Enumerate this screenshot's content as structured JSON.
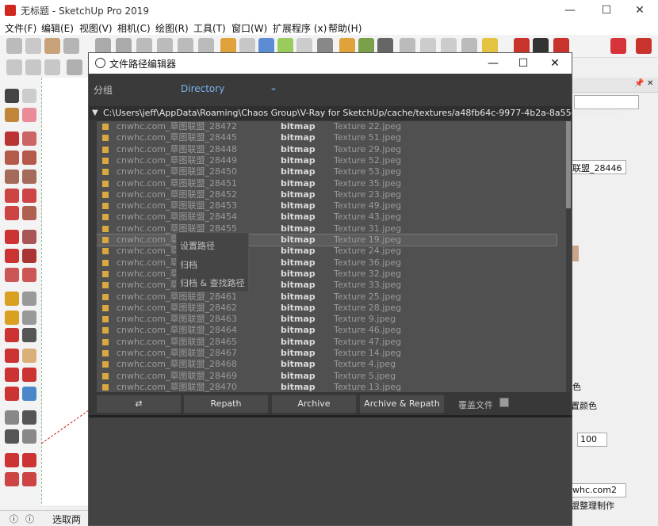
{
  "app": {
    "title": "无标题 - SketchUp Pro 2019"
  },
  "menu": [
    "文件(F)",
    "编辑(E)",
    "视图(V)",
    "相机(C)",
    "绘图(R)",
    "工具(T)",
    "窗口(W)",
    "扩展程序 (x)",
    "帮助(H)"
  ],
  "dialog": {
    "title": "文件路径编辑器",
    "group_label": "分组",
    "group_value": "Directory",
    "path": "C:\\Users\\jeff\\AppData\\Roaming\\Chaos Group\\V-Ray for SketchUp/cache/textures/a48fb64c-9977-4b2a-8a55-edb7f617...",
    "rows": [
      {
        "name": "cnwhc.com_草图联盟_28472",
        "type": "bitmap",
        "file": "Texture 22.jpeg"
      },
      {
        "name": "cnwhc.com_草图联盟_28445",
        "type": "bitmap",
        "file": "Texture 51.jpeg"
      },
      {
        "name": "cnwhc.com_草图联盟_28448",
        "type": "bitmap",
        "file": "Texture 29.jpeg"
      },
      {
        "name": "cnwhc.com_草图联盟_28449",
        "type": "bitmap",
        "file": "Texture 52.jpeg"
      },
      {
        "name": "cnwhc.com_草图联盟_28450",
        "type": "bitmap",
        "file": "Texture 53.jpeg"
      },
      {
        "name": "cnwhc.com_草图联盟_28451",
        "type": "bitmap",
        "file": "Texture 35.jpeg"
      },
      {
        "name": "cnwhc.com_草图联盟_28452",
        "type": "bitmap",
        "file": "Texture 23.jpeg"
      },
      {
        "name": "cnwhc.com_草图联盟_28453",
        "type": "bitmap",
        "file": "Texture 49.jpeg"
      },
      {
        "name": "cnwhc.com_草图联盟_28454",
        "type": "bitmap",
        "file": "Texture 43.jpeg"
      },
      {
        "name": "cnwhc.com_草图联盟_28455",
        "type": "bitmap",
        "file": "Texture 31.jpeg"
      },
      {
        "name": "cnwhc.com_草图",
        "type": "bitmap",
        "file": "Texture 19.jpeg"
      },
      {
        "name": "cnwhc.com_草图",
        "type": "bitmap",
        "file": "Texture 24.jpeg"
      },
      {
        "name": "cnwhc.com_草图",
        "type": "bitmap",
        "file": "Texture 36.jpeg"
      },
      {
        "name": "cnwhc.com_草图",
        "type": "bitmap",
        "file": "Texture 32.jpeg"
      },
      {
        "name": "cnwhc.com_草图",
        "type": "bitmap",
        "file": "Texture 33.jpeg"
      },
      {
        "name": "cnwhc.com_草图联盟_28461",
        "type": "bitmap",
        "file": "Texture 25.jpeg"
      },
      {
        "name": "cnwhc.com_草图联盟_28462",
        "type": "bitmap",
        "file": "Texture 28.jpeg"
      },
      {
        "name": "cnwhc.com_草图联盟_28463",
        "type": "bitmap",
        "file": "Texture 9.jpeg"
      },
      {
        "name": "cnwhc.com_草图联盟_28464",
        "type": "bitmap",
        "file": "Texture 46.jpeg"
      },
      {
        "name": "cnwhc.com_草图联盟_28465",
        "type": "bitmap",
        "file": "Texture 47.jpeg"
      },
      {
        "name": "cnwhc.com_草图联盟_28467",
        "type": "bitmap",
        "file": "Texture 14.jpeg"
      },
      {
        "name": "cnwhc.com_草图联盟_28468",
        "type": "bitmap",
        "file": "Texture 4.jpeg"
      },
      {
        "name": "cnwhc.com_草图联盟_28469",
        "type": "bitmap",
        "file": "Texture 5.jpeg"
      },
      {
        "name": "cnwhc.com_草图联盟_28470",
        "type": "bitmap",
        "file": "Texture 13.jpeg"
      }
    ],
    "context_menu": [
      "设置路径",
      "归档",
      "归档 & 查找路径"
    ],
    "buttons": {
      "repath": "Repath",
      "archive": "Archive",
      "archive_repath": "Archive & Repath"
    },
    "overwrite_label": "覆盖文件"
  },
  "right_panel": {
    "entity_name": "联盟_28446",
    "color_label": "色",
    "reset_color": "置颜色",
    "opacity_value": "100",
    "material_name": "whc.com2",
    "sketch_label": "盟整理制作"
  },
  "status": {
    "text": "选取两"
  },
  "colors": {
    "dialog_bg": "#383838",
    "list_bg": "#505050",
    "accent": "#79b4ee",
    "folder": "#d9a840"
  }
}
